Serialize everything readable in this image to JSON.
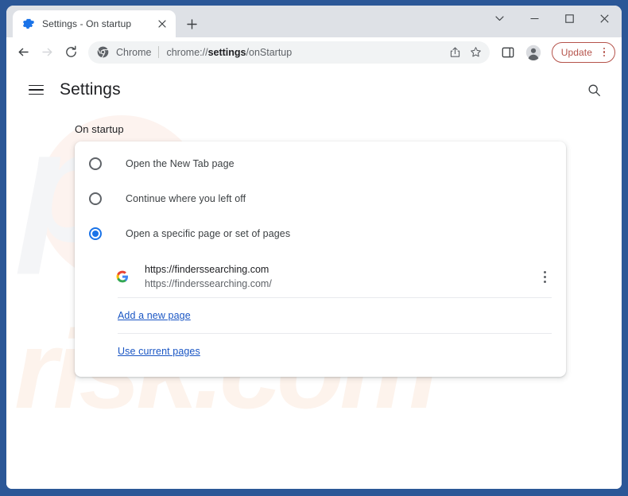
{
  "window": {
    "frame_color": "#2b5797",
    "controls": [
      {
        "name": "tab-search-button",
        "glyph": "chevron-down-icon"
      },
      {
        "name": "minimize-button",
        "glyph": "minimize-icon"
      },
      {
        "name": "maximize-button",
        "glyph": "maximize-icon"
      },
      {
        "name": "close-button",
        "glyph": "close-icon"
      }
    ]
  },
  "tab_strip": {
    "active_tab": {
      "title": "Settings - On startup",
      "favicon": "settings-gear-icon",
      "close_label": "×"
    },
    "new_tab_label": "+"
  },
  "toolbar": {
    "back_label": "←",
    "forward_label": "→",
    "reload_label": "⟳",
    "omnibox": {
      "brand_icon": "chrome-logo-icon",
      "scheme_label": "Chrome",
      "url_prefix": "chrome://",
      "url_bold": "settings",
      "url_suffix": "/onStartup",
      "share_icon": "share-icon",
      "bookmark_icon": "star-icon"
    },
    "side_panel_icon": "side-panel-icon",
    "profile_icon": "profile-avatar-icon",
    "update": {
      "label": "Update",
      "accent_color": "#b5534b"
    }
  },
  "settings": {
    "menu_icon": "hamburger-menu-icon",
    "title": "Settings",
    "search_icon": "search-icon",
    "section_title": "On startup",
    "accent_color": "#1a73e8",
    "link_color": "#1a56c4",
    "startup_options": [
      {
        "label": "Open the New Tab page",
        "selected": false
      },
      {
        "label": "Continue where you left off",
        "selected": false
      },
      {
        "label": "Open a specific page or set of pages",
        "selected": true
      }
    ],
    "startup_pages": [
      {
        "favicon": "google-g-icon",
        "title": "https://finderssearching.com",
        "url": "https://finderssearching.com/",
        "menu_icon": "more-vertical-icon"
      }
    ],
    "add_page_link": "Add a new page",
    "use_current_pages_link": "Use current pages"
  },
  "watermark": {
    "top_text": "pc",
    "bottom_text": "risk.com"
  }
}
